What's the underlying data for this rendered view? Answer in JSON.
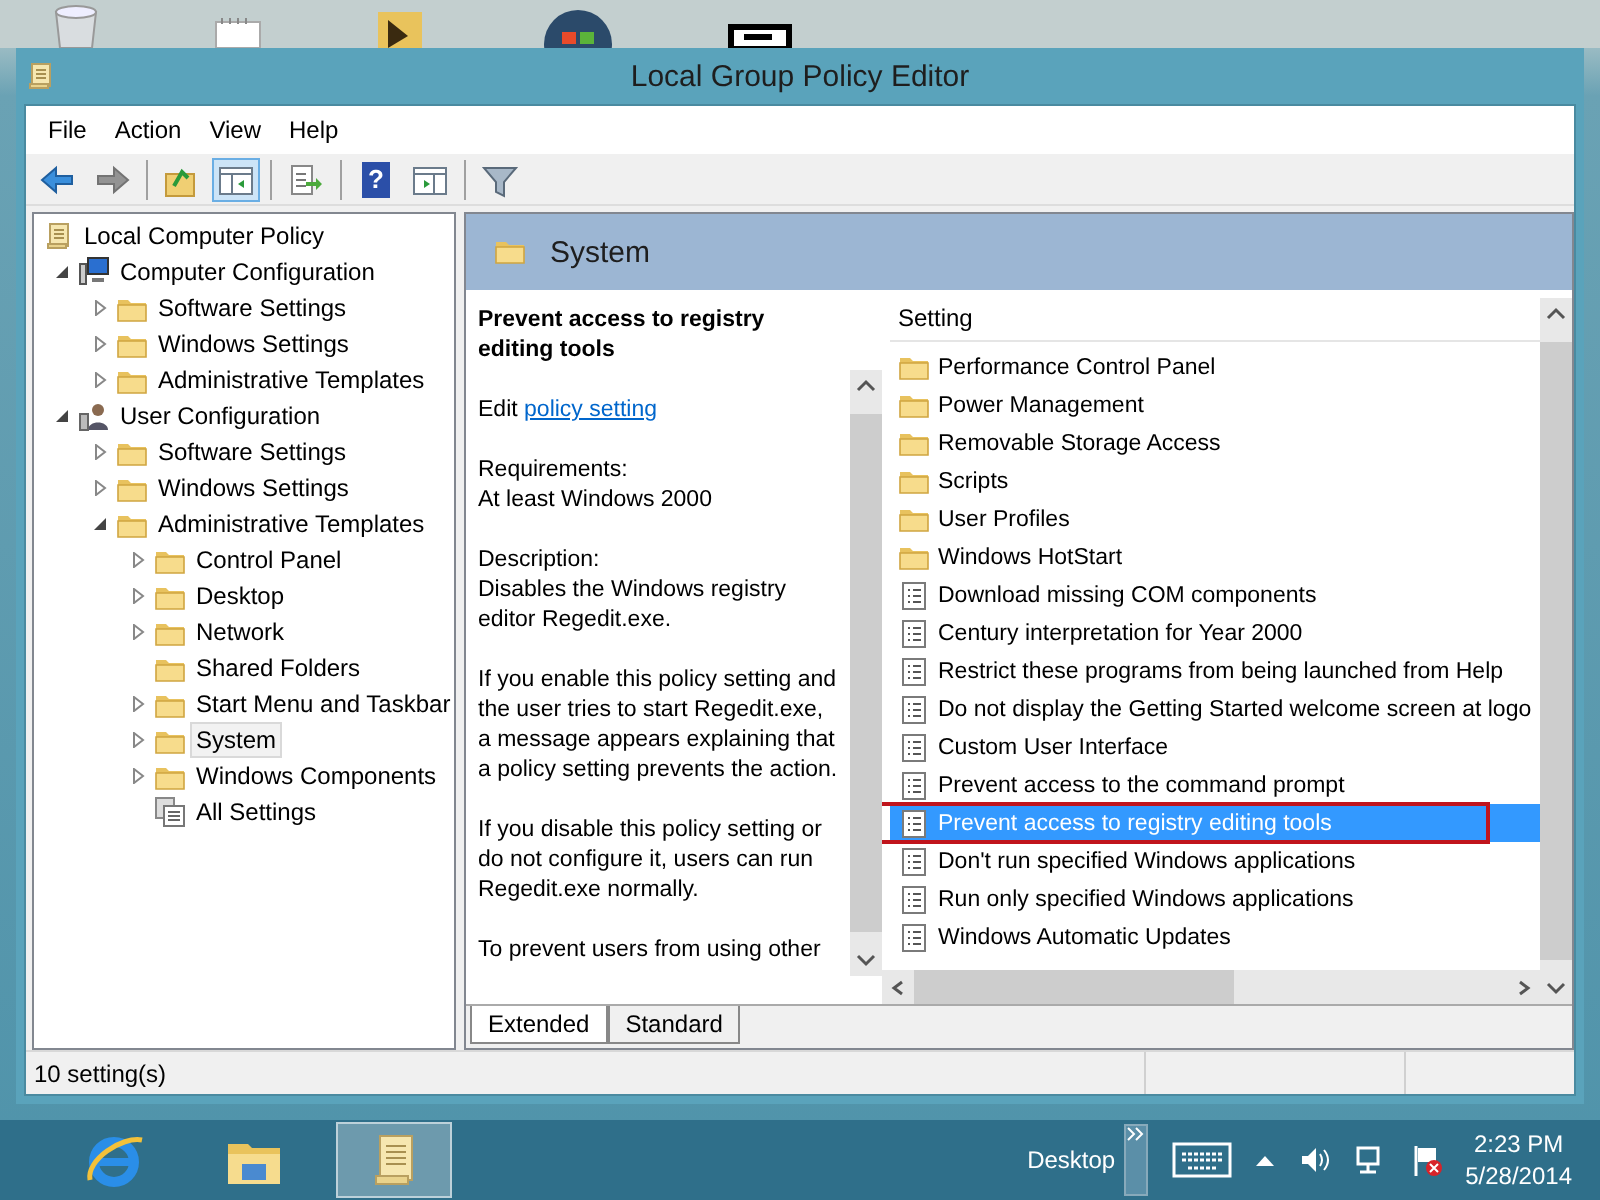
{
  "window": {
    "title": "Local Group Policy Editor"
  },
  "menu": [
    "File",
    "Action",
    "View",
    "Help"
  ],
  "toolbar": [
    {
      "kind": "back",
      "pressed": false,
      "disabled": false
    },
    {
      "kind": "forward",
      "pressed": false,
      "disabled": true
    },
    {
      "kind": "up",
      "pressed": false,
      "disabled": false
    },
    {
      "kind": "tree-toggle",
      "pressed": true,
      "disabled": false
    },
    {
      "kind": "export",
      "pressed": false,
      "disabled": false
    },
    {
      "kind": "help",
      "glyph": "?",
      "pressed": false,
      "disabled": false
    },
    {
      "kind": "panel",
      "pressed": false,
      "disabled": false
    },
    {
      "kind": "filter",
      "pressed": false,
      "disabled": false
    }
  ],
  "tree": {
    "label": "Local Computer Policy",
    "kind": "policy",
    "selected": false,
    "children": [
      {
        "label": "Computer Configuration",
        "kind": "computer",
        "expanded": true,
        "selected": false,
        "children": [
          {
            "label": "Software Settings",
            "kind": "folder",
            "expanded": false,
            "selected": false
          },
          {
            "label": "Windows Settings",
            "kind": "folder",
            "expanded": false,
            "selected": false
          },
          {
            "label": "Administrative Templates",
            "kind": "folder",
            "expanded": false,
            "selected": false
          }
        ]
      },
      {
        "label": "User Configuration",
        "kind": "user",
        "expanded": true,
        "selected": false,
        "children": [
          {
            "label": "Software Settings",
            "kind": "folder",
            "expanded": false,
            "selected": false
          },
          {
            "label": "Windows Settings",
            "kind": "folder",
            "expanded": false,
            "selected": false
          },
          {
            "label": "Administrative Templates",
            "kind": "folder",
            "expanded": true,
            "selected": false,
            "children": [
              {
                "label": "Control Panel",
                "kind": "folder",
                "expanded": false,
                "selected": false
              },
              {
                "label": "Desktop",
                "kind": "folder",
                "expanded": false,
                "selected": false
              },
              {
                "label": "Network",
                "kind": "folder",
                "expanded": false,
                "selected": false
              },
              {
                "label": "Shared Folders",
                "kind": "folder",
                "selected": false
              },
              {
                "label": "Start Menu and Taskbar",
                "kind": "folder",
                "expanded": false,
                "selected": false
              },
              {
                "label": "System",
                "kind": "folder",
                "expanded": false,
                "selected": true
              },
              {
                "label": "Windows Components",
                "kind": "folder",
                "expanded": false,
                "selected": false
              },
              {
                "label": "All Settings",
                "kind": "all-settings",
                "selected": false
              }
            ]
          }
        ]
      }
    ]
  },
  "details": {
    "header": "System",
    "title": "Prevent access to registry editing tools",
    "edit_prefix": "Edit",
    "edit_link": "policy setting",
    "paragraphs": [
      [
        "Requirements:",
        "At least Windows 2000"
      ],
      [
        "Description:",
        "Disables the Windows registry editor Regedit.exe."
      ],
      [
        "If you enable this policy setting and the user tries to start Regedit.exe, a message appears explaining that a policy setting prevents the action."
      ],
      [
        "If you disable this policy setting or do not configure it, users can run Regedit.exe normally."
      ],
      [
        "To prevent users from using other"
      ]
    ]
  },
  "settings": {
    "column": "Setting",
    "items": [
      {
        "label": "Performance Control Panel",
        "kind": "folder",
        "selected": false,
        "annotated": false
      },
      {
        "label": "Power Management",
        "kind": "folder",
        "selected": false,
        "annotated": false
      },
      {
        "label": "Removable Storage Access",
        "kind": "folder",
        "selected": false,
        "annotated": false
      },
      {
        "label": "Scripts",
        "kind": "folder",
        "selected": false,
        "annotated": false
      },
      {
        "label": "User Profiles",
        "kind": "folder",
        "selected": false,
        "annotated": false
      },
      {
        "label": "Windows HotStart",
        "kind": "folder",
        "selected": false,
        "annotated": false
      },
      {
        "label": "Download missing COM components",
        "kind": "setting",
        "selected": false,
        "annotated": false
      },
      {
        "label": "Century interpretation for Year 2000",
        "kind": "setting",
        "selected": false,
        "annotated": false
      },
      {
        "label": "Restrict these programs from being launched from Help",
        "kind": "setting",
        "selected": false,
        "annotated": false
      },
      {
        "label": "Do not display the Getting Started welcome screen at logo",
        "kind": "setting",
        "selected": false,
        "annotated": false
      },
      {
        "label": "Custom User Interface",
        "kind": "setting",
        "selected": false,
        "annotated": false
      },
      {
        "label": "Prevent access to the command prompt",
        "kind": "setting",
        "selected": false,
        "annotated": false
      },
      {
        "label": "Prevent access to registry editing tools",
        "kind": "setting",
        "selected": true,
        "annotated": true
      },
      {
        "label": "Don't run specified Windows applications",
        "kind": "setting",
        "selected": false,
        "annotated": false
      },
      {
        "label": "Run only specified Windows applications",
        "kind": "setting",
        "selected": false,
        "annotated": false
      },
      {
        "label": "Windows Automatic Updates",
        "kind": "setting",
        "selected": false,
        "annotated": false
      }
    ]
  },
  "tabs": [
    {
      "label": "Extended",
      "selected": true
    },
    {
      "label": "Standard",
      "selected": false
    }
  ],
  "status_bar": {
    "text": "10 setting(s)"
  },
  "taskbar": {
    "apps": [
      {
        "kind": "browser",
        "active": false
      },
      {
        "kind": "file-explorer",
        "active": false
      },
      {
        "kind": "policy-editor",
        "active": true
      }
    ],
    "desktop_label": "Desktop",
    "time": "2:23 PM",
    "date": "5/28/2014"
  }
}
